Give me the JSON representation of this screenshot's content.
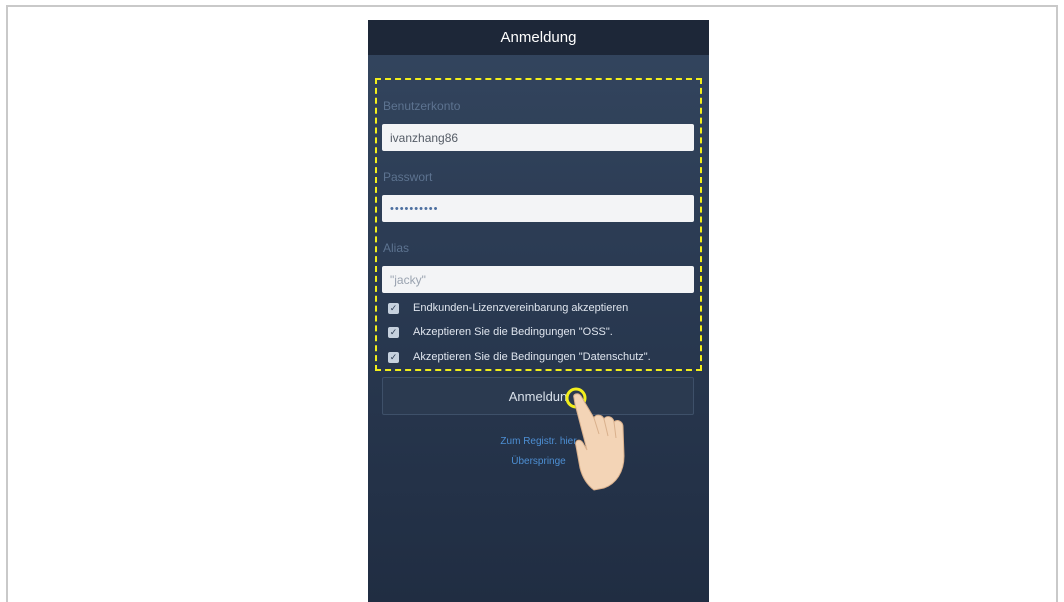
{
  "screen": {
    "title": "Anmeldung"
  },
  "form": {
    "account_label": "Benutzerkonto",
    "account_value": "ivanzhang86",
    "password_label": "Passwort",
    "password_value": "••••••••••",
    "alias_label": "Alias",
    "alias_placeholder": "\"jacky\""
  },
  "agreements": [
    {
      "label": "Endkunden-Lizenzvereinbarung akzeptieren",
      "checked": true
    },
    {
      "label": "Akzeptieren Sie die Bedingungen \"OSS\".",
      "checked": true
    },
    {
      "label": "Akzeptieren Sie die Bedingungen \"Datenschutz\".",
      "checked": true
    }
  ],
  "actions": {
    "login_label": "Anmeldun",
    "register_link": "Zum Registr. hier",
    "skip_link": "Überspringe"
  },
  "colors": {
    "highlight": "#f2ee1c",
    "link": "#4d8fd4",
    "background": "#2a3a52"
  }
}
